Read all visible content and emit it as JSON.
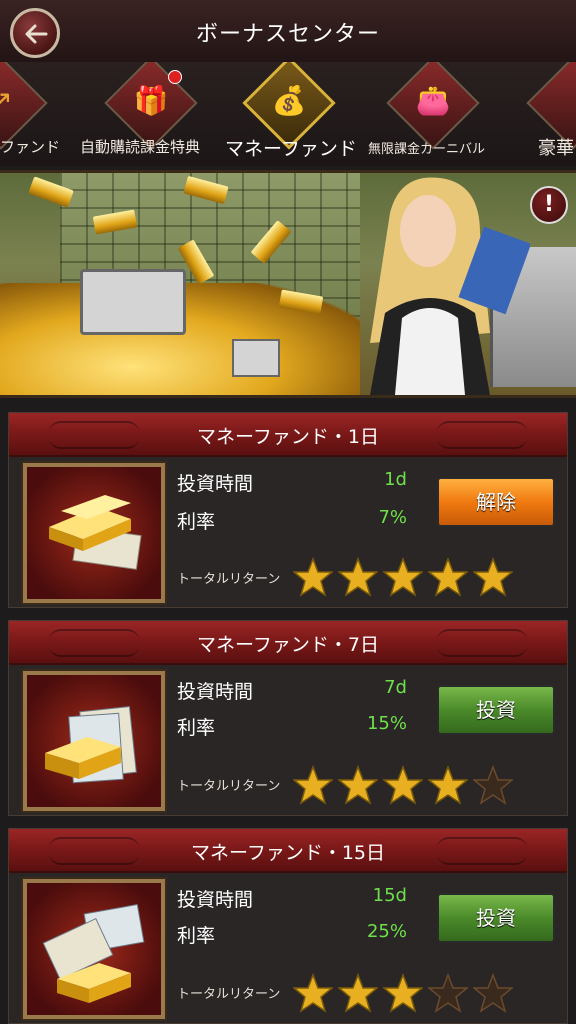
{
  "header": {
    "title": "ボーナスセンター",
    "back_icon": "back-arrow-icon"
  },
  "tabs": [
    {
      "label": "ファンド",
      "icon": "fund-icon",
      "active": false
    },
    {
      "label": "自動購読課金特典",
      "icon": "gift-box-icon",
      "active": false,
      "notification": true
    },
    {
      "label": "マネーファンド",
      "icon": "money-fund-icon",
      "active": true
    },
    {
      "label": "無限課金カーニバル",
      "icon": "wallet-icon",
      "active": false
    },
    {
      "label": "豪華",
      "icon": "luxury-icon",
      "active": false
    }
  ],
  "banner": {
    "info_icon": "info-icon",
    "info_glyph": "!"
  },
  "colors": {
    "accent_red": "#8a1e1e",
    "value_green": "#6ee04a",
    "gold": "#e0a416"
  },
  "funds": [
    {
      "title": "マネーファンド・1日",
      "time_label": "投資時間",
      "time_value": "1d",
      "rate_label": "利率",
      "rate_value": "7%",
      "return_label": "トータルリターン",
      "button_label": "解除",
      "button_style": "orange",
      "stars_filled": 5,
      "stars_total": 5
    },
    {
      "title": "マネーファンド・7日",
      "time_label": "投資時間",
      "time_value": "7d",
      "rate_label": "利率",
      "rate_value": "15%",
      "return_label": "トータルリターン",
      "button_label": "投資",
      "button_style": "green",
      "stars_filled": 4,
      "stars_total": 5
    },
    {
      "title": "マネーファンド・15日",
      "time_label": "投資時間",
      "time_value": "15d",
      "rate_label": "利率",
      "rate_value": "25%",
      "return_label": "トータルリターン",
      "button_label": "投資",
      "button_style": "green",
      "stars_filled": 3,
      "stars_total": 5
    }
  ]
}
